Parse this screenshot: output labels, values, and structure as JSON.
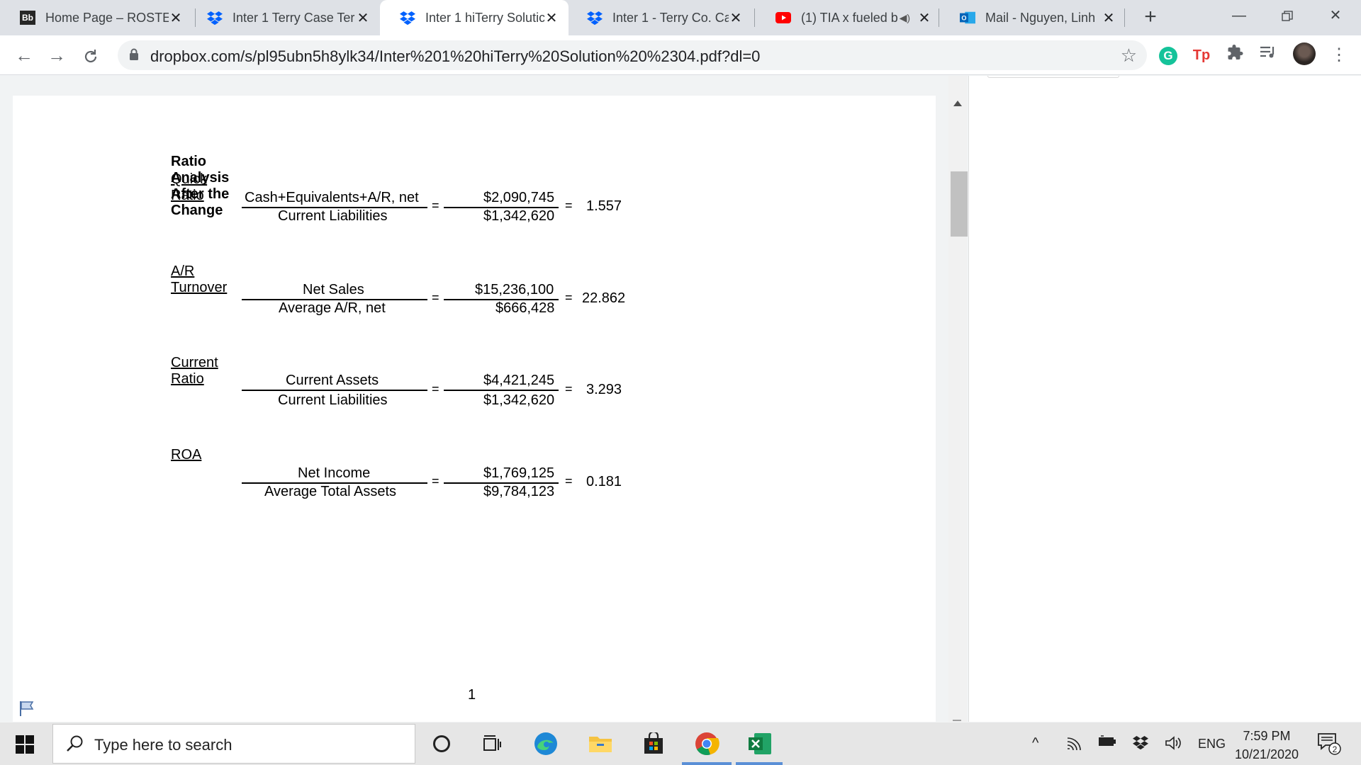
{
  "browser": {
    "tabs": [
      {
        "title": "Home Page – ROSTE",
        "favicon": "blackboard-icon",
        "active": false
      },
      {
        "title": "Inter 1 Terry Case Ter",
        "favicon": "dropbox-icon",
        "active": false
      },
      {
        "title": "Inter 1 hiTerry Solutic",
        "favicon": "dropbox-icon",
        "active": true
      },
      {
        "title": "Inter 1 - Terry Co. Ca",
        "favicon": "dropbox-icon",
        "active": false
      },
      {
        "title": "(1) TIA x fueled b",
        "favicon": "youtube-icon",
        "active": false
      },
      {
        "title": "Mail - Nguyen, Linh",
        "favicon": "outlook-icon",
        "active": false
      }
    ],
    "url": "dropbox.com/s/pl95ubn5h8ylk34/Inter%201%20hiTerry%20Solution%20%2304.pdf?dl=0",
    "favicon_badge": "Bb",
    "extension_labels": {
      "grammarly": "G",
      "tp": "Tp"
    }
  },
  "document": {
    "heading": "Ratio Analysis After the Change",
    "ratios": [
      {
        "name": "Quick Ratio",
        "numerator_label": "Cash+Equivalents+A/R, net",
        "denominator_label": "Current Liabilities",
        "numerator_value": "$2,090,745",
        "denominator_value": "$1,342,620",
        "result": "1.557"
      },
      {
        "name": "A/R Turnover",
        "numerator_label": "Net Sales",
        "denominator_label": "Average A/R, net",
        "numerator_value": "$15,236,100",
        "denominator_value": "$666,428",
        "result": "22.862"
      },
      {
        "name": "Current Ratio",
        "numerator_label": "Current Assets",
        "denominator_label": "Current Liabilities",
        "numerator_value": "$4,421,245",
        "denominator_value": "$1,342,620",
        "result": "3.293"
      },
      {
        "name": "ROA",
        "numerator_label": "Net Income",
        "denominator_label": "Average Total Assets",
        "numerator_value": "$1,769,125",
        "denominator_value": "$9,784,123",
        "result": "0.181"
      }
    ],
    "equals": "=",
    "page_number": "1"
  },
  "taskbar": {
    "search_placeholder": "Type here to search",
    "language": "ENG",
    "time": "7:59 PM",
    "date": "10/21/2020",
    "notification_count": "2"
  }
}
